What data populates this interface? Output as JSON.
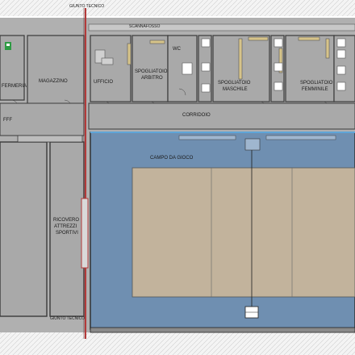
{
  "plan": {
    "joint_top": "GIUNTO TECNICO",
    "joint_bottom": "GIUNTO TECNICO",
    "scannafosso": "SCANNAFOSSO",
    "rooms": {
      "infermeria": "FERMERIA",
      "magazzino": "MAGAZZINO",
      "ufficio": "UFFICIO",
      "spogliatoio_arbitro_1": "SPOGLIATOIO",
      "spogliatoio_arbitro_2": "ARBITRO",
      "wc": "WC",
      "spogliatoio_maschile_1": "SPOGLIATOIO",
      "spogliatoio_maschile_2": "MASCHILE",
      "spogliatoio_femminile_1": "SPOGLIATOIO",
      "spogliatoio_femminile_2": "FEMMINILE",
      "fff": "FFF",
      "corridoio": "CORRIDOIO",
      "campo": "CAMPO DA GIOCO",
      "ricovero_1": "RICOVERO",
      "ricovero_2": "ATTREZZI",
      "ricovero_3": "SPORTIVI"
    },
    "colors": {
      "room_fill": "#a9a9a9",
      "wall": "#3a3a3a",
      "joint": "#b33a3a",
      "hall_blue": "#6f8fb1",
      "court": "#c2b39c",
      "exit_sign": "#2e9b43"
    }
  }
}
